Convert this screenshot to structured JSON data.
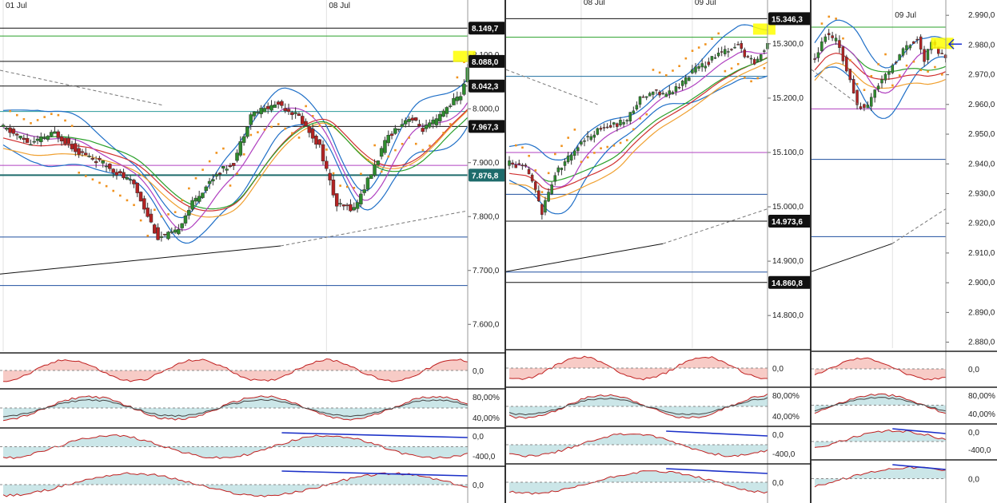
{
  "colors": {
    "up": "#2e8b2e",
    "down": "#b22222",
    "bollinger": "#1f6fc7",
    "ema_fast": "#b040c0",
    "ema_mid": "#2aa02a",
    "ema_slow": "#d03030",
    "ema_long": "#f0a030",
    "sar": "#f0921e",
    "highlight": "#ffff00",
    "tag_bg": "#111111",
    "tag_teal": "#1d6b6b",
    "blue_line": "#1b30c8",
    "arrow": "#1b30d0"
  },
  "chart_data": [
    {
      "type": "candlestick",
      "name": "left",
      "date_labels": [
        {
          "label": "01 Jul",
          "i": 0
        },
        {
          "label": "08 Jul",
          "i": 94
        }
      ],
      "ylim": [
        7550,
        8190
      ],
      "yticks": [
        "7.600,0",
        "7.700,0",
        "7.800,0",
        "7.900,0",
        "8.000,0",
        "8.100,0"
      ],
      "price_tags": [
        {
          "label": "8.149,7",
          "value": 8149.7,
          "style": "dark"
        },
        {
          "label": "8.088,0",
          "value": 8088.0,
          "style": "dark"
        },
        {
          "label": "8.042,3",
          "value": 8042.3,
          "style": "dark"
        },
        {
          "label": "7.967,3",
          "value": 7967.3,
          "style": "dark"
        },
        {
          "label": "7.876,8",
          "value": 7876.8,
          "style": "teal"
        }
      ],
      "hlines": [
        {
          "value": 8149.7,
          "color": "#111111"
        },
        {
          "value": 8135,
          "color": "#2aa02a"
        },
        {
          "value": 8088.0,
          "color": "#111111"
        },
        {
          "value": 8042.3,
          "color": "#111111"
        },
        {
          "value": 7995,
          "color": "#2a9a9a"
        },
        {
          "value": 7967.3,
          "color": "#111111"
        },
        {
          "value": 7895,
          "color": "#b040c0"
        },
        {
          "value": 7876.8,
          "color": "#1d6b6b",
          "width": 2
        },
        {
          "value": 7762,
          "color": "#1f4f9f"
        },
        {
          "value": 7672,
          "color": "#1f4f9f"
        }
      ],
      "waypoints": [
        [
          0,
          7965
        ],
        [
          8,
          7935
        ],
        [
          15,
          7955
        ],
        [
          22,
          7920
        ],
        [
          30,
          7895
        ],
        [
          38,
          7860
        ],
        [
          45,
          7760
        ],
        [
          50,
          7770
        ],
        [
          55,
          7825
        ],
        [
          62,
          7880
        ],
        [
          67,
          7900
        ],
        [
          72,
          7990
        ],
        [
          80,
          8010
        ],
        [
          86,
          7985
        ],
        [
          92,
          7930
        ],
        [
          97,
          7820
        ],
        [
          102,
          7815
        ],
        [
          107,
          7880
        ],
        [
          112,
          7950
        ],
        [
          118,
          7985
        ],
        [
          122,
          7962
        ],
        [
          126,
          7978
        ],
        [
          130,
          8010
        ],
        [
          133,
          8025
        ],
        [
          135,
          8072
        ]
      ],
      "oscillators": [
        {
          "ticks": [
            "0,0"
          ]
        },
        {
          "ticks": [
            "80,00%",
            "40,00%"
          ]
        },
        {
          "ticks": [
            "0,0",
            "-400,0"
          ]
        },
        {
          "ticks": [
            "0,0"
          ]
        }
      ]
    },
    {
      "type": "candlestick",
      "name": "middle",
      "date_labels": [
        {
          "label": "08 Jul",
          "i": 22
        },
        {
          "label": "09 Jul",
          "i": 56
        }
      ],
      "ylim": [
        14740,
        15360
      ],
      "yticks": [
        "14.800,0",
        "14.900,0",
        "15.000,0",
        "15.100,0",
        "15.200,0",
        "15.300,0"
      ],
      "price_tags": [
        {
          "label": "15.346,3",
          "value": 15346.3,
          "style": "dark"
        },
        {
          "label": "14.973,6",
          "value": 14973.6,
          "style": "dark"
        },
        {
          "label": "14.860,8",
          "value": 14860.8,
          "style": "dark"
        }
      ],
      "hlines": [
        {
          "value": 15346.3,
          "color": "#111111"
        },
        {
          "value": 15312,
          "color": "#2aa02a"
        },
        {
          "value": 15240,
          "color": "#1f6fa0"
        },
        {
          "value": 15100,
          "color": "#b040c0"
        },
        {
          "value": 15023,
          "color": "#1f4f9f"
        },
        {
          "value": 14973.6,
          "color": "#111111"
        },
        {
          "value": 14880,
          "color": "#1f4f9f"
        },
        {
          "value": 14860.8,
          "color": "#111111"
        }
      ],
      "waypoints": [
        [
          0,
          15080
        ],
        [
          5,
          15070
        ],
        [
          8,
          15030
        ],
        [
          10,
          14990
        ],
        [
          14,
          15060
        ],
        [
          18,
          15090
        ],
        [
          22,
          15120
        ],
        [
          28,
          15145
        ],
        [
          32,
          15150
        ],
        [
          36,
          15160
        ],
        [
          40,
          15200
        ],
        [
          44,
          15215
        ],
        [
          48,
          15205
        ],
        [
          52,
          15222
        ],
        [
          56,
          15250
        ],
        [
          60,
          15262
        ],
        [
          64,
          15282
        ],
        [
          68,
          15292
        ],
        [
          70,
          15300
        ],
        [
          72,
          15275
        ],
        [
          75,
          15265
        ],
        [
          77,
          15283
        ],
        [
          79,
          15302
        ]
      ],
      "oscillators": [
        {
          "ticks": [
            "0,0"
          ]
        },
        {
          "ticks": [
            "80,00%",
            "40,00%"
          ]
        },
        {
          "ticks": [
            "0,0",
            "-400,0"
          ]
        },
        {
          "ticks": [
            "0,0"
          ]
        }
      ]
    },
    {
      "type": "candlestick",
      "name": "right",
      "date_labels": [
        {
          "label": "09 Jul",
          "i": 22
        }
      ],
      "ylim": [
        2.878,
        2.993
      ],
      "yticks": [
        "2.880,0",
        "2.890,0",
        "2.900,0",
        "2.910,0",
        "2.920,0",
        "2.930,0",
        "2.940,0",
        "2.950,0",
        "2.960,0",
        "2.970,0",
        "2.980,0",
        "2.990,0"
      ],
      "price_tags": [],
      "hlines": [
        {
          "value": 2.986,
          "color": "#2aa02a"
        },
        {
          "value": 2.9585,
          "color": "#b040c0"
        },
        {
          "value": 2.9415,
          "color": "#1f4f9f"
        },
        {
          "value": 2.9155,
          "color": "#1f4f9f"
        }
      ],
      "waypoints": [
        [
          0,
          2.975
        ],
        [
          3,
          2.983
        ],
        [
          6,
          2.982
        ],
        [
          9,
          2.972
        ],
        [
          12,
          2.96
        ],
        [
          14,
          2.958
        ],
        [
          17,
          2.965
        ],
        [
          20,
          2.97
        ],
        [
          23,
          2.975
        ],
        [
          26,
          2.98
        ],
        [
          29,
          2.982
        ],
        [
          31,
          2.975
        ],
        [
          33,
          2.981
        ],
        [
          35,
          2.978
        ],
        [
          37,
          2.976
        ]
      ],
      "oscillators": [
        {
          "ticks": [
            "0,0"
          ]
        },
        {
          "ticks": [
            "80,00%",
            "40,00%"
          ]
        },
        {
          "ticks": [
            "0,0",
            "-400,0"
          ]
        },
        {
          "ticks": [
            "0,0"
          ]
        }
      ]
    }
  ]
}
